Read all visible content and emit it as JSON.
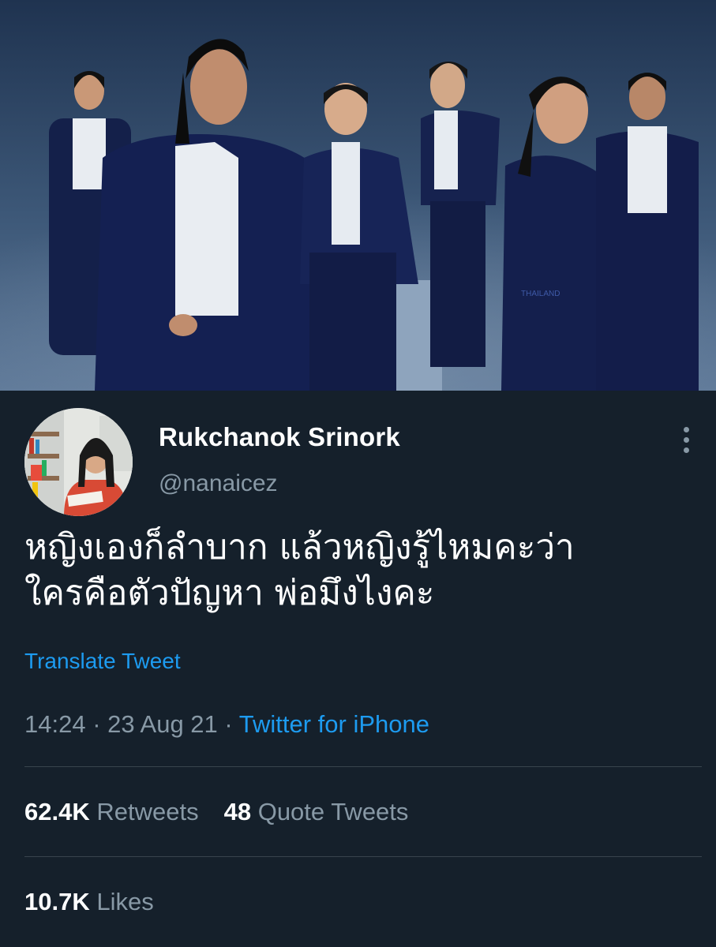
{
  "photo": {
    "jacket_text": "THAILAND"
  },
  "author": {
    "display_name": "Rukchanok Srinork",
    "handle": "@nanaicez"
  },
  "tweet": {
    "lines": [
      "หญิงเองก็ลำบาก แล้วหญิงรู้ไหมคะว่า",
      "ใครคือตัวปัญหา พ่อมึงไงคะ"
    ],
    "translate_label": "Translate Tweet",
    "time": "14:24",
    "date": "23 Aug 21",
    "separator": " · ",
    "source": "Twitter for iPhone"
  },
  "stats": {
    "retweets_count": "62.4K",
    "retweets_label": "Retweets",
    "quotes_count": "48",
    "quotes_label": "Quote Tweets",
    "likes_count": "10.7K",
    "likes_label": "Likes"
  },
  "colors": {
    "background": "#15202b",
    "secondary_text": "#8899a6",
    "link": "#1d9bf0",
    "divider": "#38444d"
  }
}
